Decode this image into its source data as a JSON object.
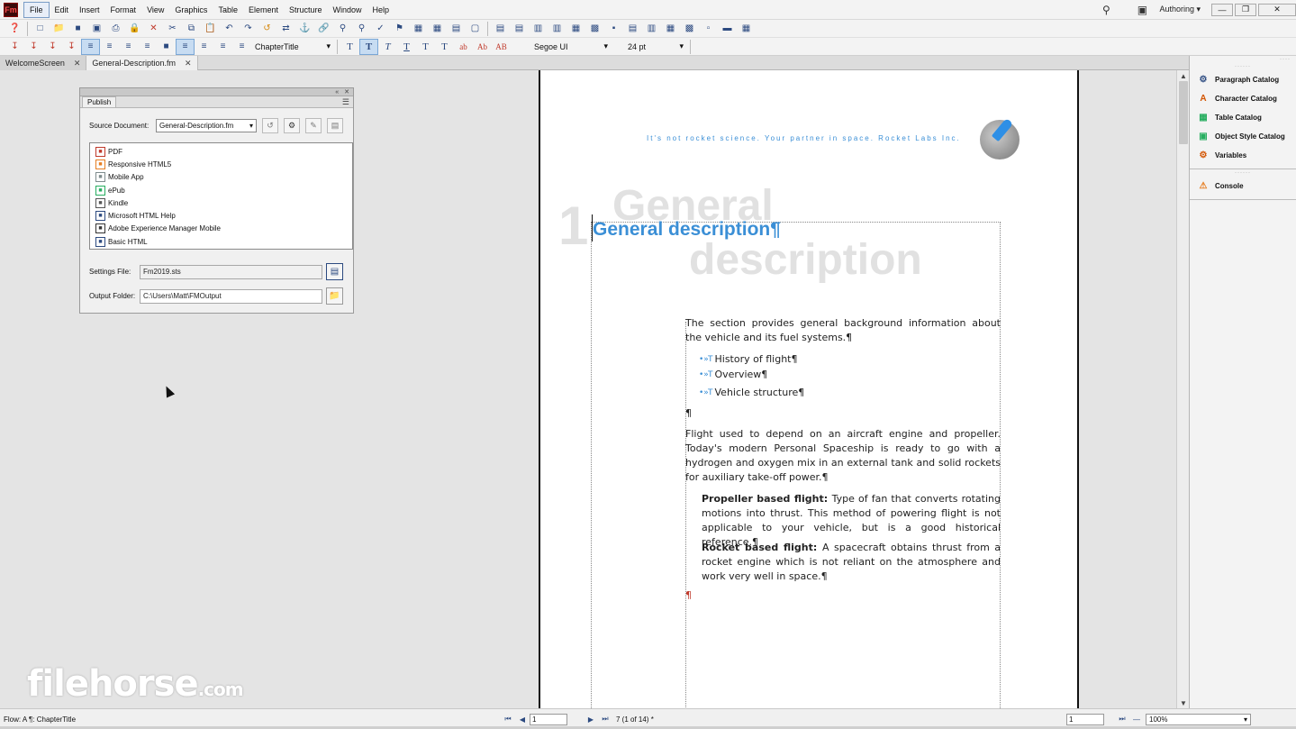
{
  "menubar": {
    "app_logo": "Fm",
    "items": [
      "File",
      "Edit",
      "Insert",
      "Format",
      "View",
      "Graphics",
      "Table",
      "Element",
      "Structure",
      "Window",
      "Help"
    ],
    "active_item": "File",
    "workspace": "Authoring",
    "icons": [
      "search-icon",
      "pod-icon"
    ],
    "window_buttons": [
      "minimize-icon",
      "restore-icon",
      "close-icon"
    ]
  },
  "toolbar2": {
    "paragraph_tag": "ChapterTitle",
    "font": "Segoe UI",
    "font_size": "24 pt",
    "text_buttons": [
      "T",
      "T",
      "T",
      "T",
      "T",
      "T",
      "ab",
      "Ab",
      "AB"
    ]
  },
  "doc_tabs": [
    {
      "label": "WelcomeScreen",
      "active": false
    },
    {
      "label": "General-Description.fm",
      "active": true
    }
  ],
  "publish_panel": {
    "tab": "Publish",
    "source_label": "Source Document:",
    "source_value": "General-Description.fm",
    "outputs": [
      {
        "label": "PDF",
        "icon": "pdf-icon",
        "color": "#c0392b"
      },
      {
        "label": "Responsive HTML5",
        "icon": "html5-icon",
        "color": "#e67e22"
      },
      {
        "label": "Mobile App",
        "icon": "mobile-icon",
        "color": "#7f8c8d"
      },
      {
        "label": "ePub",
        "icon": "epub-icon",
        "color": "#27ae60"
      },
      {
        "label": "Kindle",
        "icon": "kindle-icon",
        "color": "#555555"
      },
      {
        "label": "Microsoft HTML Help",
        "icon": "chm-icon",
        "color": "#2c4a80"
      },
      {
        "label": "Adobe Experience Manager Mobile",
        "icon": "aem-icon",
        "color": "#333333"
      },
      {
        "label": "Basic HTML",
        "icon": "html-icon",
        "color": "#2c4a80"
      }
    ],
    "settings_label": "Settings File:",
    "settings_value": "Fm2019.sts",
    "output_label": "Output Folder:",
    "output_value": "C:\\Users\\Matt\\FMOutput"
  },
  "page": {
    "tagline": "It's not rocket science. Your partner in space. Rocket Labs Inc.",
    "chapter_number": "1",
    "ghost_title_line1": "General",
    "ghost_title_line2": "description",
    "heading": "General description¶",
    "intro": "The section provides general background information about the vehicle and its fuel systems.¶",
    "bullets": [
      "History of flight¶",
      "Overview¶",
      "Vehicle structure¶"
    ],
    "bullet_prefix": "•»T",
    "empty_para": "¶",
    "flight_para": "Flight used to depend on an aircraft engine and propeller. Today's modern Personal Spaceship is ready to go with a hydrogen and oxygen mix in an external tank and solid rockets for auxiliary take-off power.¶",
    "propeller_term": "Propeller based flight: ",
    "propeller_text": "Type of fan that converts rotating motions into thrust. This method of powering flight is not applicable to your vehicle, but is a good historical reference.¶",
    "rocket_term": "Rocket based flight: ",
    "rocket_text": "A spacecraft obtains thrust from a rocket engine which is not reliant on the atmosphere and work very well in space.¶",
    "end_mark": "¶"
  },
  "right_pods": {
    "group1": [
      {
        "label": "Paragraph Catalog",
        "icon": "paragraph-catalog-icon"
      },
      {
        "label": "Character Catalog",
        "icon": "character-catalog-icon"
      },
      {
        "label": "Table Catalog",
        "icon": "table-catalog-icon"
      },
      {
        "label": "Object Style Catalog",
        "icon": "object-style-icon"
      },
      {
        "label": "Variables",
        "icon": "variables-icon"
      }
    ],
    "group2": [
      {
        "label": "Console",
        "icon": "console-warning-icon"
      }
    ]
  },
  "statusbar": {
    "flow": "Flow: A  ¶: ChapterTitle",
    "page_field": "1",
    "page_of": "7 (1 of 14) *",
    "right_field": "1",
    "zoom": "100%"
  },
  "watermark": {
    "text": "filehorse",
    "suffix": ".com"
  }
}
